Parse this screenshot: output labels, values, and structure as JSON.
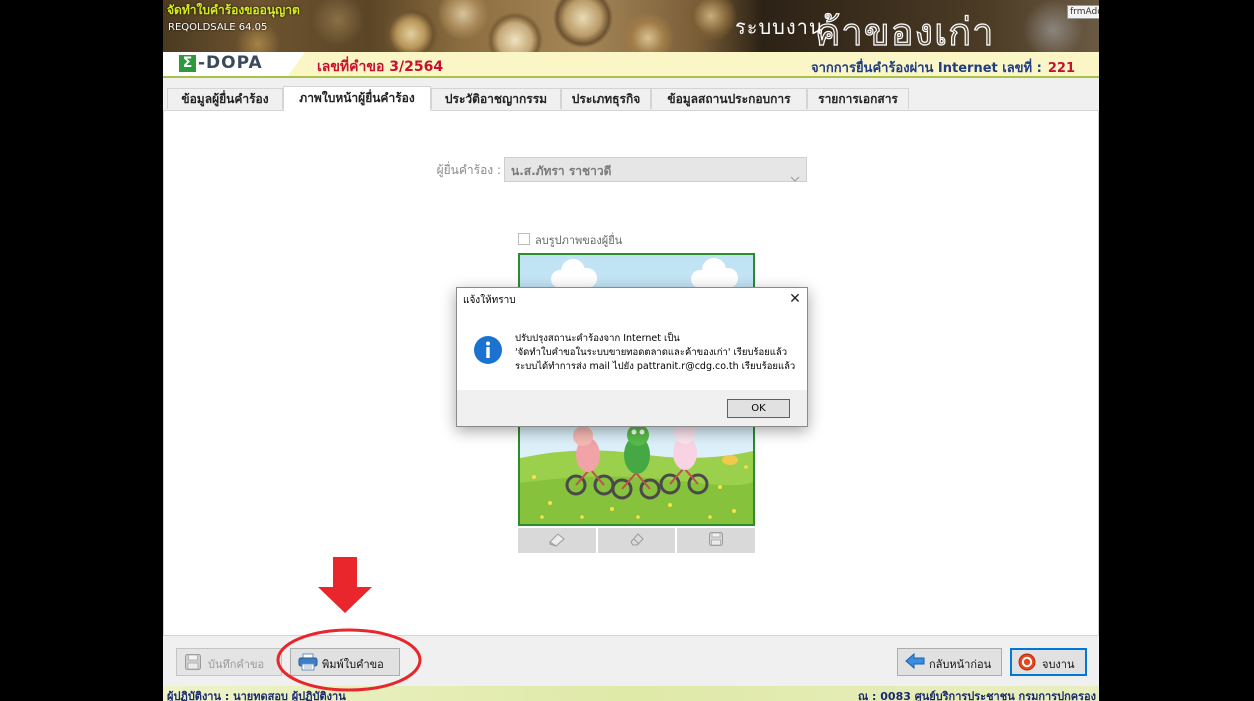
{
  "window": {
    "title": "จัดทำใบคำร้องขออนุญาต",
    "version": "REQOLDSALE 64.05",
    "system_prefix": "ระบบงาน",
    "system_name": "ค้าของเก่า",
    "form_tag": "frmAdd"
  },
  "infobar": {
    "logo_symbol": "Σ",
    "logo_text": "-DOPA",
    "request_number": "เลขที่คำขอ 3/2564",
    "internet_label": "จากการยื่นคำร้องผ่าน Internet เลขที่ :",
    "internet_number": "221"
  },
  "tabs": [
    {
      "label": "ข้อมูลผู้ยื่นคำร้อง",
      "active": false
    },
    {
      "label": "ภาพใบหน้าผู้ยื่นคำร้อง",
      "active": true
    },
    {
      "label": "ประวัติอาชญากรรม",
      "active": false
    },
    {
      "label": "ประเภทธุรกิจ",
      "active": false
    },
    {
      "label": "ข้อมูลสถานประกอบการ",
      "active": false
    },
    {
      "label": "รายการเอกสาร",
      "active": false
    }
  ],
  "photo_tab": {
    "applicant_label": "ผู้ยื่นคำร้อง :",
    "applicant_value": "น.ส.ภัทรา ราชาวดี",
    "applicant_enabled": false,
    "delete_photo_label": "ลบรูปภาพของผู้ยื่น",
    "delete_photo_checked": false,
    "image_toolbar": [
      {
        "icon": "scan-icon",
        "enabled": false
      },
      {
        "icon": "eraser-icon",
        "enabled": false
      },
      {
        "icon": "floppy-icon",
        "enabled": false
      }
    ]
  },
  "dialog": {
    "title": "แจ้งให้ทราบ",
    "icon": "info-icon",
    "message_lines": [
      "ปรับปรุงสถานะคำร้องจาก Internet เป็น",
      "'จัดทำใบคำขอในระบบขายทอดตลาดและค้าของเก่า' เรียบร้อยแล้ว",
      "ระบบได้ทำการส่ง mail ไปยัง pattranit.r@cdg.co.th เรียบร้อยแล้ว"
    ],
    "ok_label": "OK"
  },
  "footer": {
    "save": {
      "label": "บันทึกคำขอ",
      "icon": "floppy-icon",
      "enabled": false
    },
    "print": {
      "label": "พิมพ์ใบคำขอ",
      "icon": "printer-icon",
      "enabled": true
    },
    "back": {
      "label": "กลับหน้าก่อน",
      "icon": "back-arrow-icon",
      "enabled": true
    },
    "finish": {
      "label": "จบงาน",
      "icon": "power-icon",
      "enabled": true,
      "focused": true
    }
  },
  "statusbar": {
    "operator": "ผู้ปฏิบัติงาน : นายทดสอบ ผู้ปฏิบัติงาน",
    "office": "ณ : 0083 ศูนย์บริการประชาชน กรมการปกครอง"
  },
  "annotations": {
    "color": "#e8262b",
    "shapes": [
      "down-arrow",
      "ellipse-highlight"
    ]
  },
  "colors": {
    "request_red": "#c8102e",
    "navy": "#1f3c88",
    "title_green": "#d7ec1a",
    "image_border": "#2e8b2e",
    "focus_blue": "#0078d7",
    "annotation_red": "#e8262b"
  }
}
